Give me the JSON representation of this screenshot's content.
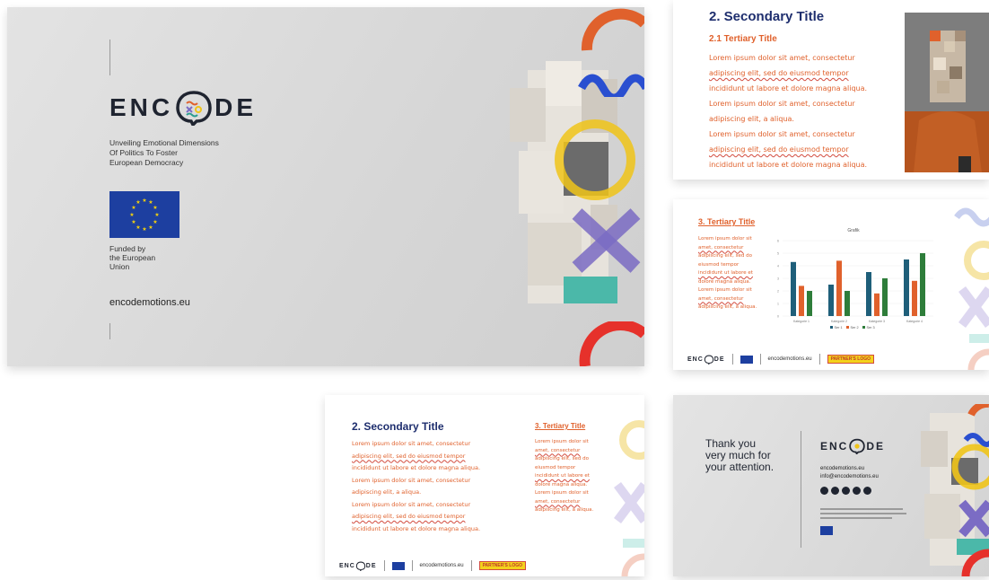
{
  "cover": {
    "logo_text_left": "ENC",
    "logo_text_right": "DE",
    "subtitle_lines": [
      "Unveiling Emotional Dimensions",
      "Of Politics To Foster",
      "European Democracy"
    ],
    "funded_lines": [
      "Funded by",
      "the European",
      "Union"
    ],
    "website": "encodemotions.eu"
  },
  "slide2": {
    "title": "2. Secondary Title",
    "subtitle": "2.1 Tertiary Title",
    "body_lines": [
      "Lorem ipsum dolor sit amet, consectetur",
      "adipiscing elit, sed do eiusmod tempor",
      "incididunt ut labore et dolore magna aliqua.",
      "Lorem ipsum dolor sit amet, consectetur",
      "adipiscing elit, a aliqua.",
      "Lorem ipsum dolor sit amet, consectetur",
      "adipiscing elit, sed do eiusmod tempor",
      "incididunt ut labore et dolore magna aliqua."
    ]
  },
  "slide3": {
    "title": "3. Tertiary Title",
    "body_lines": [
      "Lorem ipsum dolor sit",
      "amet, consectetur",
      "adipiscing elit, sed do",
      "eiusmod tempor",
      "incididunt ut labore et",
      "dolore magna aliqua.",
      "Lorem ipsum dolor sit",
      "amet, consectetur",
      "adipiscing elit, a aliqua."
    ],
    "footer_site": "encodemotions.eu",
    "partner": "PARTNER'S LOGO"
  },
  "slide4": {
    "title": "2. Secondary Title",
    "tertiary": "3. Tertiary Title",
    "body_lines": [
      "Lorem ipsum dolor sit amet, consectetur",
      "adipiscing elit, sed do eiusmod tempor",
      "incididunt ut labore et dolore magna aliqua.",
      "Lorem ipsum dolor sit amet, consectetur",
      "adipiscing elit, a aliqua.",
      "Lorem ipsum dolor sit amet, consectetur",
      "adipiscing elit, sed do eiusmod tempor",
      "incididunt ut labore et dolore magna aliqua."
    ],
    "side_lines": [
      "Lorem ipsum dolor sit",
      "amet, consectetur",
      "adipiscing elit, sed do",
      "eiusmod tempor",
      "incididunt ut labore et",
      "dolore magna aliqua.",
      "Lorem ipsum dolor sit",
      "amet, consectetur",
      "adipiscing elit, a aliqua."
    ],
    "footer_site": "encodemotions.eu",
    "partner": "PARTNER'S LOGO"
  },
  "slide5": {
    "thanks_lines": [
      "Thank you",
      "very much for",
      "your attention."
    ],
    "contact_lines": [
      "encodemotions.eu",
      "info@encodemotions.eu"
    ]
  },
  "chart_data": {
    "type": "bar",
    "title": "Grafik",
    "categories": [
      "Kategorie 1",
      "Kategorie 2",
      "Kategorie 3",
      "Kategorie 4"
    ],
    "series": [
      {
        "name": "Ser 1",
        "values": [
          4.3,
          2.5,
          3.5,
          4.5
        ]
      },
      {
        "name": "Ser 2",
        "values": [
          2.4,
          4.4,
          1.8,
          2.8
        ]
      },
      {
        "name": "Ser 3",
        "values": [
          2.0,
          2.0,
          3.0,
          5.0
        ]
      }
    ],
    "colors": [
      "#1f5f7a",
      "#e0612c",
      "#2e7d3a"
    ],
    "ylim": [
      0,
      6
    ],
    "legend": "bottom"
  }
}
